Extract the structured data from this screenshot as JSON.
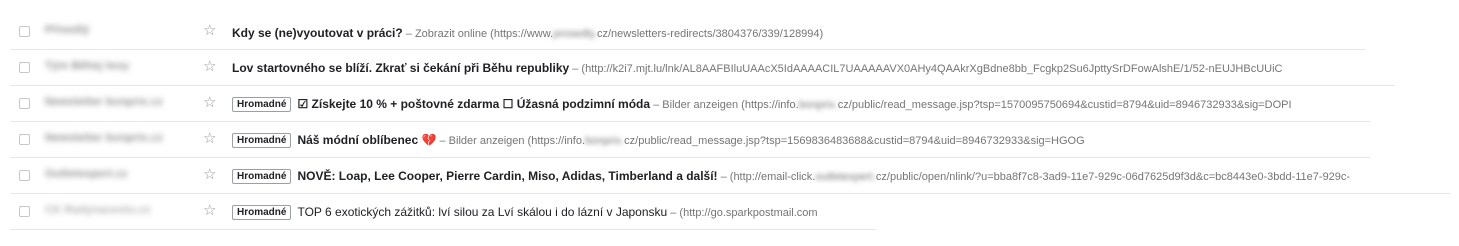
{
  "mailbox": {
    "rows": [
      {
        "sender": "Přísedlý",
        "tag": "",
        "subject": "Kdy se (ne)vyoutovat v práci?",
        "subject_weight": "bold",
        "separator": " – ",
        "snippet_before": "Zobrazit online (https://www.",
        "snippet_blur": "prosedly.",
        "snippet_after": "cz/newsletters-redirects/3804376/339/128994)"
      },
      {
        "sender": "Tým Běhej teoy",
        "tag": "",
        "subject": "Lov startovného se blíží. Zkrať si čekání při Běhu republiky",
        "subject_weight": "bold",
        "separator": " – ",
        "snippet_before": "(http://k2i7.mjt.lu/lnk/AL8AAFBIluUAAcX5IdAAAACIL7UAAAAAVX0AHy4QAAkrXgBdne8bb_Fcgkp2Su6JpttySrDFowAlshE/1/52-nEUJHBcUUiC",
        "snippet_blur": "",
        "snippet_after": ""
      },
      {
        "sender": "Newsletter bonprix.cz",
        "tag": "Hromadné",
        "subject": "☑ Získejte 10 % + poštovné zdarma ☐ Úžasná podzimní móda",
        "subject_weight": "bold",
        "separator": " – ",
        "snippet_before": "Bilder anzeigen (https://info.",
        "snippet_blur": "bonprix.",
        "snippet_after": "cz/public/read_message.jsp?tsp=1570095750694&custid=8794&uid=8946732933&sig=DOPI"
      },
      {
        "sender": "Newsletter bonprix.cz",
        "tag": "Hromadné",
        "subject": "Náš módní oblíbenec",
        "subject_icon": "💔",
        "subject_weight": "bold",
        "separator": " – ",
        "snippet_before": "Bilder anzeigen (https://info.",
        "snippet_blur": "bonprix.",
        "snippet_after": "cz/public/read_message.jsp?tsp=1569836483688&custid=8794&uid=8946732933&sig=HGOG"
      },
      {
        "sender": "Outletexpert.cz",
        "tag": "Hromadné",
        "subject": "NOVĚ: Loap, Lee Cooper, Pierre Cardin, Miso, Adidas, Timberland a další!",
        "subject_weight": "bold",
        "separator": " – ",
        "snippet_before": "(http://email-click.",
        "snippet_blur": "outletexpert.",
        "snippet_after": "cz/public/open/nlink/?u=bba8f7c8-3ad9-11e7-929c-06d7625d9f3d&c=bc8443e0-3bdd-11e7-929c-"
      },
      {
        "sender": "CK Radynacestu.cz",
        "tag": "Hromadné",
        "subject": "TOP 6 exotických zážitků: lví silou za Lví skálou i do lázní v Japonsku",
        "subject_weight": "normal",
        "separator": " – ",
        "snippet_before": "(http://go.sparkpostmail.com",
        "snippet_blur": "",
        "snippet_after": ""
      }
    ]
  },
  "icons": {
    "checkbox": "checkbox-icon",
    "star": "star-icon"
  },
  "colors": {
    "text": "#202124",
    "snippet": "#757575",
    "divider": "#e6e6e6",
    "star": "#9a9a9a"
  }
}
